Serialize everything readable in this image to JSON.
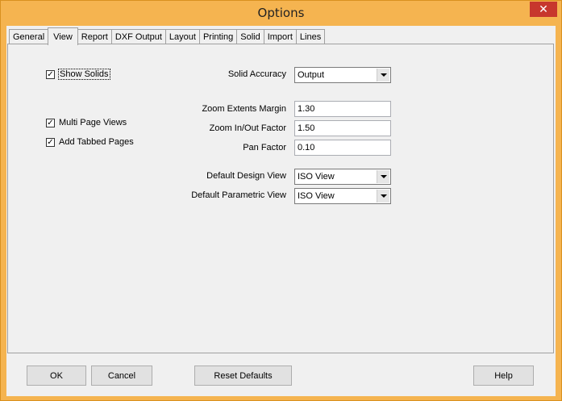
{
  "window": {
    "title": "Options",
    "close_glyph": "✕"
  },
  "tabs": [
    {
      "label": "General"
    },
    {
      "label": "View",
      "active": true
    },
    {
      "label": "Report"
    },
    {
      "label": "DXF Output"
    },
    {
      "label": "Layout"
    },
    {
      "label": "Printing"
    },
    {
      "label": "Solid"
    },
    {
      "label": "Import"
    },
    {
      "label": "Lines"
    }
  ],
  "view": {
    "show_solids": {
      "label": "Show Solids",
      "checked": true
    },
    "multi_page_views": {
      "label": "Multi Page Views",
      "checked": true
    },
    "add_tabbed_pages": {
      "label": "Add Tabbed Pages",
      "checked": true
    },
    "solid_accuracy": {
      "label": "Solid Accuracy",
      "value": "Output"
    },
    "zoom_extents_margin": {
      "label": "Zoom Extents Margin",
      "value": "1.30"
    },
    "zoom_factor": {
      "label": "Zoom In/Out Factor",
      "value": "1.50"
    },
    "pan_factor": {
      "label": "Pan Factor",
      "value": "0.10"
    },
    "default_design_view": {
      "label": "Default Design View",
      "value": "ISO View"
    },
    "default_parametric_view": {
      "label": "Default Parametric View",
      "value": "ISO View"
    }
  },
  "buttons": {
    "ok": "OK",
    "cancel": "Cancel",
    "reset_defaults": "Reset Defaults",
    "help": "Help"
  },
  "check_glyph": "✓"
}
